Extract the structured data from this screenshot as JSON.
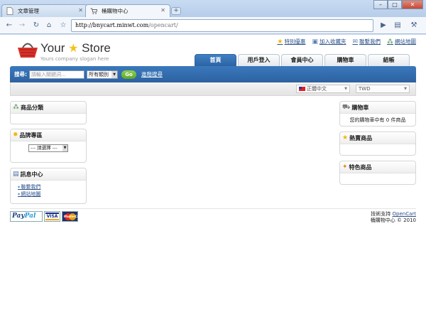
{
  "browser": {
    "tabs": [
      {
        "title": "文章管理",
        "active": false
      },
      {
        "title": "桶購物中心",
        "active": true
      }
    ],
    "new_tab": "+",
    "window_buttons": [
      "–",
      "□",
      "✕"
    ],
    "url_host": "http://bnycart.minwt.com",
    "url_path": "/opencart/"
  },
  "site": {
    "logo_your": "Your",
    "logo_store": "Store",
    "slogan": "Yours company slogan here",
    "toplinks": [
      {
        "label": "特別優惠",
        "icon": "star-icon"
      },
      {
        "label": "加入收藏夾",
        "icon": "bookmark-icon"
      },
      {
        "label": "聯繫我們",
        "icon": "mail-icon"
      },
      {
        "label": "網站地圖",
        "icon": "sitemap-icon"
      }
    ],
    "nav": [
      "首頁",
      "用戶登入",
      "會員中心",
      "購物車",
      "結帳"
    ]
  },
  "search": {
    "label": "搜尋:",
    "placeholder": "請輸入關鍵詞...",
    "category": "所有類別",
    "go": "Go",
    "advanced": "進階搜尋"
  },
  "prefs": {
    "language": "正體中文",
    "currency": "TWD"
  },
  "left": {
    "categories_title": "商品分類",
    "brand_title": "品牌專區",
    "brand_select": "--- 請選擇 ---",
    "info_title": "訊息中心",
    "info_links": [
      "聯繫我們",
      "網站地圖"
    ]
  },
  "right": {
    "cart_title": "購物車",
    "cart_text": "您的購物車中有 0 件商品",
    "bestseller_title": "熱賣商品",
    "featured_title": "特色商品"
  },
  "footer": {
    "paypal_a": "Pay",
    "paypal_b": "Pal",
    "visa": "VISA",
    "mastercard": "MasterCard",
    "powered": "技術支持",
    "powered_link": "OpenCart",
    "copyright": "桶購物中心 © 2010"
  }
}
